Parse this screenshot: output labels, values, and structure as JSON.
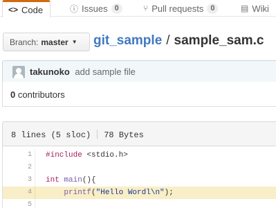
{
  "tabs": [
    {
      "label": "Code",
      "icon": "code-icon",
      "icon_glyph": "<>",
      "active": true
    },
    {
      "label": "Issues",
      "icon": "issue-icon",
      "icon_glyph": "ⓘ",
      "count": "0"
    },
    {
      "label": "Pull requests",
      "icon": "pull-request-icon",
      "icon_glyph": "⑂",
      "count": "0"
    },
    {
      "label": "Wiki",
      "icon": "book-icon",
      "icon_glyph": "▤"
    }
  ],
  "branch": {
    "prefix": "Branch:",
    "name": "master",
    "caret": "▼"
  },
  "breadcrumb": {
    "repo": "git_sample",
    "separator": "/",
    "file": "sample_sam.c"
  },
  "commit": {
    "author": "takunoko",
    "message": "add sample file"
  },
  "contributors": {
    "count": "0",
    "label": "contributors"
  },
  "file_info": {
    "lines": "8 lines (5 sloc)",
    "size": "78 Bytes"
  },
  "code": {
    "lines": [
      {
        "number": "1",
        "text": "#include <stdio.h>"
      },
      {
        "number": "2",
        "text": ""
      },
      {
        "number": "3",
        "text": "int main(){"
      },
      {
        "number": "4",
        "text": "    printf(\"Hello Wordl\\n\");",
        "highlighted": true
      },
      {
        "number": "5",
        "text": ""
      }
    ]
  },
  "colors": {
    "link": "#4078c0",
    "tab_accent": "#d26911",
    "highlight": "#f8eec7"
  }
}
